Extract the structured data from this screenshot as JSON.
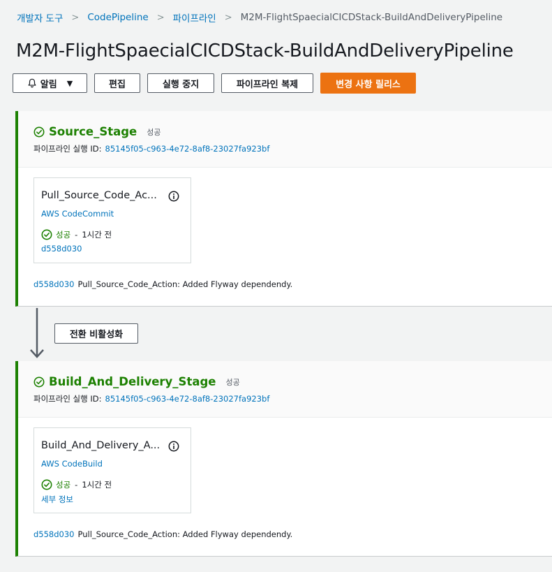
{
  "breadcrumb": {
    "items": [
      "개발자 도구",
      "CodePipeline",
      "파이프라인"
    ],
    "current": "M2M-FlightSpaecialCICDStack-BuildAndDeliveryPipeline",
    "separator": ">"
  },
  "page": {
    "title": "M2M-FlightSpaecialCICDStack-BuildAndDeliveryPipeline"
  },
  "toolbar": {
    "notify_label": "알림",
    "edit_label": "편집",
    "stop_label": "실행 중지",
    "clone_label": "파이프라인 복제",
    "release_label": "변경 사항 릴리스"
  },
  "transition": {
    "button_label": "전환 비활성화"
  },
  "stages": [
    {
      "name": "Source_Stage",
      "status": "성공",
      "execution_label": "파이프라인 실행 ID:",
      "execution_id": "85145f05-c963-4e72-8af8-23027fa923bf",
      "action": {
        "name": "Pull_Source_Code_Ac...",
        "provider": "AWS CodeCommit",
        "status": "성공",
        "dash": "-",
        "time": "1시간 전",
        "link": "d558d030"
      },
      "commit_id": "d558d030",
      "commit_message": "Pull_Source_Code_Action: Added Flyway dependendy."
    },
    {
      "name": "Build_And_Delivery_Stage",
      "status": "성공",
      "execution_label": "파이프라인 실행 ID:",
      "execution_id": "85145f05-c963-4e72-8af8-23027fa923bf",
      "action": {
        "name": "Build_And_Delivery_A...",
        "provider": "AWS CodeBuild",
        "status": "성공",
        "dash": "-",
        "time": "1시간 전",
        "link": "세부 정보"
      },
      "commit_id": "d558d030",
      "commit_message": "Pull_Source_Code_Action: Added Flyway dependendy."
    }
  ],
  "colors": {
    "success": "#1d8102",
    "link": "#0073bb",
    "primary_button": "#ec7211",
    "background": "#f2f3f3"
  }
}
